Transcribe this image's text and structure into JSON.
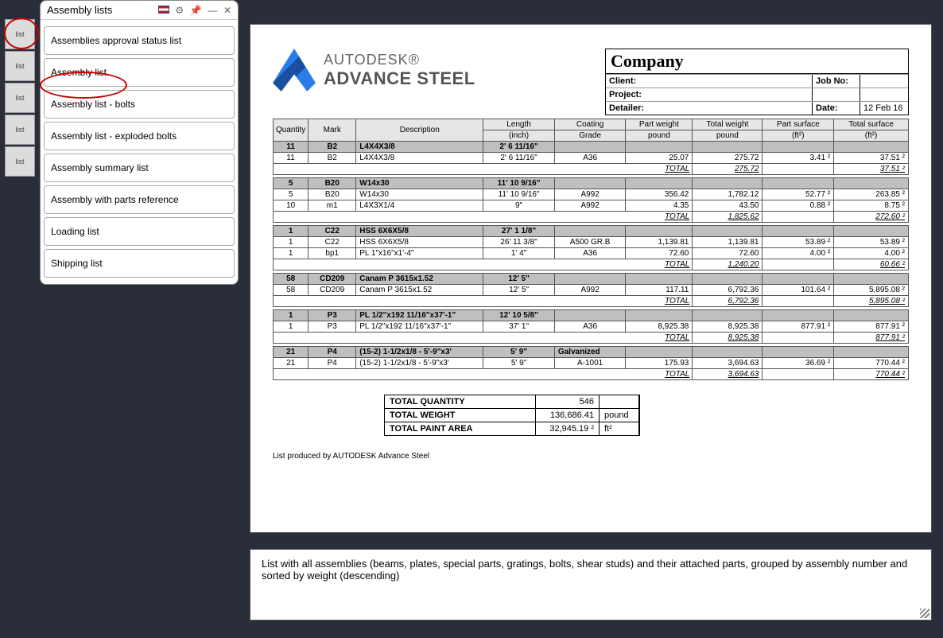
{
  "panel": {
    "title": "Assembly lists",
    "items": [
      "Assemblies approval status list",
      "Assembly list",
      "Assembly list - bolts",
      "Assembly list - exploded bolts",
      "Assembly summary list",
      "Assembly with parts reference",
      "Loading list",
      "Shipping list"
    ]
  },
  "brand": {
    "line1": "AUTODESK®",
    "line2": "ADVANCE STEEL"
  },
  "company": {
    "title": "Company",
    "clientLbl": "Client:",
    "projectLbl": "Project:",
    "detailerLbl": "Detailer:",
    "jobLbl": "Job No:",
    "dateLbl": "Date:",
    "dateVal": "12 Feb 16"
  },
  "cols": {
    "qty": "Quantity",
    "mark": "Mark",
    "desc": "Description",
    "len": "Length",
    "coat": "Coating",
    "pw": "Part weight",
    "tw": "Total weight",
    "ps": "Part surface",
    "ts": "Total surface",
    "unitLen": "(inch)",
    "unitCoat": "Grade",
    "unitPw": "pound",
    "unitTw": "pound",
    "unitPs": "(ft²)",
    "unitTs": "(ft²)"
  },
  "groups": [
    {
      "head": {
        "qty": "11",
        "mark": "B2",
        "desc": "L4X4X3/8",
        "len": "2' 6 11/16\""
      },
      "rows": [
        {
          "qty": "11",
          "mark": "B2",
          "desc": "L4X4X3/8",
          "len": "2' 6 11/16\"",
          "coat": "A36",
          "pw": "25.07",
          "tw": "275.72",
          "ps": "3.41 ²",
          "ts": "37.51 ²"
        }
      ],
      "total": {
        "tw": "275.72",
        "ts": "37.51 ²"
      }
    },
    {
      "head": {
        "qty": "5",
        "mark": "B20",
        "desc": "W14x30",
        "len": "11' 10 9/16\""
      },
      "rows": [
        {
          "qty": "5",
          "mark": "B20",
          "desc": "W14x30",
          "len": "11' 10 9/16\"",
          "coat": "A992",
          "pw": "356.42",
          "tw": "1,782.12",
          "ps": "52.77 ²",
          "ts": "263.85 ²"
        },
        {
          "qty": "10",
          "mark": "m1",
          "desc": "L4X3X1/4",
          "len": "9\"",
          "coat": "A992",
          "pw": "4.35",
          "tw": "43.50",
          "ps": "0.88 ²",
          "ts": "8.75 ²"
        }
      ],
      "total": {
        "tw": "1,825.62",
        "ts": "272.60 ²"
      }
    },
    {
      "head": {
        "qty": "1",
        "mark": "C22",
        "desc": "HSS 6X6X5/8",
        "len": "27' 1 1/8\""
      },
      "rows": [
        {
          "qty": "1",
          "mark": "C22",
          "desc": "HSS 6X6X5/8",
          "len": "26' 11 3/8\"",
          "coat": "A500 GR.B",
          "pw": "1,139.81",
          "tw": "1,139.81",
          "ps": "53.89 ²",
          "ts": "53.89 ²"
        },
        {
          "qty": "1",
          "mark": "bp1",
          "desc": "PL 1\"x16\"x1'-4\"",
          "len": "1' 4\"",
          "coat": "A36",
          "pw": "72.60",
          "tw": "72.60",
          "ps": "4.00 ²",
          "ts": "4.00 ²"
        }
      ],
      "total": {
        "tw": "1,240.20",
        "ts": "60.66 ²"
      }
    },
    {
      "head": {
        "qty": "58",
        "mark": "CD209",
        "desc": "Canam P 3615x1.52",
        "len": "12' 5\""
      },
      "rows": [
        {
          "qty": "58",
          "mark": "CD209",
          "desc": "Canam P 3615x1.52",
          "len": "12' 5\"",
          "coat": "A992",
          "pw": "117.11",
          "tw": "6,792.36",
          "ps": "101.64 ²",
          "ts": "5,895.08 ²"
        }
      ],
      "total": {
        "tw": "6,792.36",
        "ts": "5,895.08 ²"
      }
    },
    {
      "head": {
        "qty": "1",
        "mark": "P3",
        "desc": "PL 1/2\"x192 11/16\"x37'-1\"",
        "len": "12' 10 5/8\""
      },
      "rows": [
        {
          "qty": "1",
          "mark": "P3",
          "desc": "PL 1/2\"x192 11/16\"x37'-1\"",
          "len": "37' 1\"",
          "coat": "A36",
          "pw": "8,925.38",
          "tw": "8,925.38",
          "ps": "877.91 ²",
          "ts": "877.91 ²"
        }
      ],
      "total": {
        "tw": "8,925.38",
        "ts": "877.91 ²"
      }
    },
    {
      "head": {
        "qty": "21",
        "mark": "P4",
        "desc": "(15-2) 1-1/2x1/8 - 5'-9\"x3'",
        "len": "5' 9\"",
        "coat": "Galvanized"
      },
      "rows": [
        {
          "qty": "21",
          "mark": "P4",
          "desc": "(15-2) 1-1/2x1/8 - 5'-9\"x3'",
          "len": "5' 9\"",
          "coat": "A-1001",
          "pw": "175.93",
          "tw": "3,694.63",
          "ps": "36.69 ²",
          "ts": "770.44 ²"
        }
      ],
      "total": {
        "tw": "3,694.63",
        "ts": "770.44 ²"
      }
    }
  ],
  "summary": {
    "qtyLbl": "TOTAL QUANTITY",
    "qty": "546",
    "wtLbl": "TOTAL WEIGHT",
    "wt": "136,686.41",
    "wtUnit": "pound",
    "paLbl": "TOTAL PAINT AREA",
    "pa": "32,945.19 ²",
    "paUnit": "ft²"
  },
  "footnote": "List produced by AUTODESK Advance Steel",
  "description": "List with all assemblies (beams, plates, special parts, gratings, bolts, shear studs) and their attached parts, grouped by assembly number and sorted by weight (descending)",
  "totalLabel": "TOTAL"
}
